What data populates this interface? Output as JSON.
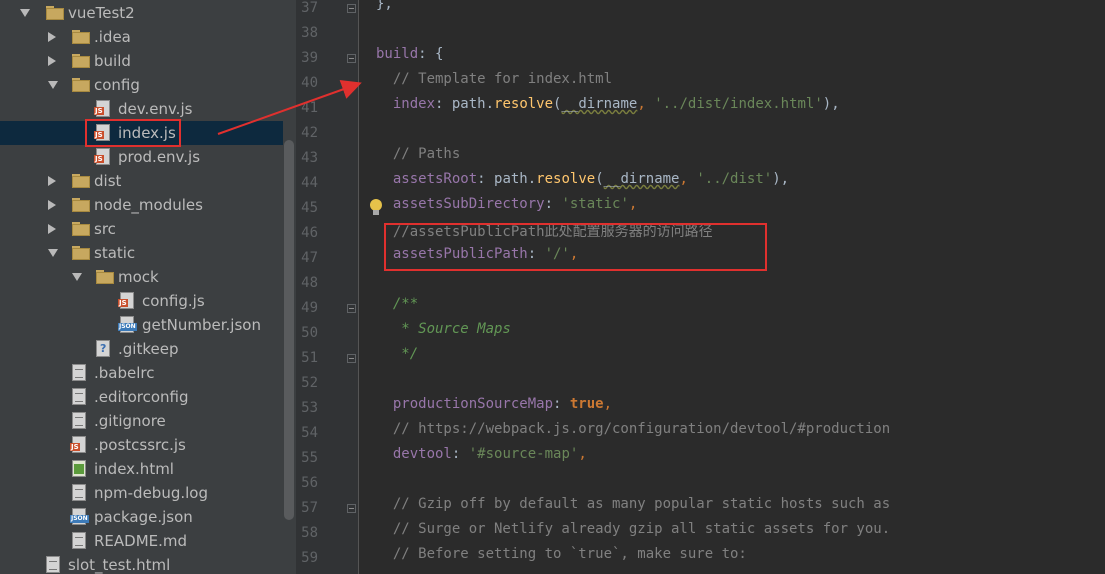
{
  "project_tree": {
    "items": [
      {
        "label": "vueTest2",
        "kind": "folder",
        "depth": 0,
        "expanded": true
      },
      {
        "label": ".idea",
        "kind": "folder",
        "depth": 1,
        "expanded": false
      },
      {
        "label": "build",
        "kind": "folder",
        "depth": 1,
        "expanded": false
      },
      {
        "label": "config",
        "kind": "folder",
        "depth": 1,
        "expanded": true
      },
      {
        "label": "dev.env.js",
        "kind": "js",
        "depth": 2
      },
      {
        "label": "index.js",
        "kind": "js",
        "depth": 2,
        "selected": true
      },
      {
        "label": "prod.env.js",
        "kind": "js",
        "depth": 2
      },
      {
        "label": "dist",
        "kind": "folder",
        "depth": 1,
        "expanded": false
      },
      {
        "label": "node_modules",
        "kind": "folder",
        "depth": 1,
        "expanded": false
      },
      {
        "label": "src",
        "kind": "folder",
        "depth": 1,
        "expanded": false
      },
      {
        "label": "static",
        "kind": "folder",
        "depth": 1,
        "expanded": true
      },
      {
        "label": "mock",
        "kind": "folder",
        "depth": 2,
        "expanded": true
      },
      {
        "label": "config.js",
        "kind": "js",
        "depth": 3
      },
      {
        "label": "getNumber.json",
        "kind": "json",
        "depth": 3
      },
      {
        "label": ".gitkeep",
        "kind": "unknown",
        "depth": 2
      },
      {
        "label": ".babelrc",
        "kind": "text",
        "depth": 1
      },
      {
        "label": ".editorconfig",
        "kind": "text",
        "depth": 1
      },
      {
        "label": ".gitignore",
        "kind": "text",
        "depth": 1
      },
      {
        "label": ".postcssrc.js",
        "kind": "js",
        "depth": 1
      },
      {
        "label": "index.html",
        "kind": "html",
        "depth": 1
      },
      {
        "label": "npm-debug.log",
        "kind": "text",
        "depth": 1
      },
      {
        "label": "package.json",
        "kind": "json",
        "depth": 1
      },
      {
        "label": "README.md",
        "kind": "text",
        "depth": 1
      },
      {
        "label": "slot_test.html",
        "kind": "text",
        "depth": 0
      }
    ]
  },
  "icons": {
    "folder": "folder-icon",
    "js": "js-file-icon",
    "json": "json-file-icon",
    "text": "text-file-icon",
    "html": "html-file-icon",
    "unknown": "unknown-file-icon",
    "fold": "fold-marker-icon",
    "bulb": "lightbulb-icon"
  },
  "editor": {
    "lines": [
      {
        "n": "37",
        "fold": true,
        "tokens": [
          {
            "t": "},",
            "c": "c-dim"
          }
        ]
      },
      {
        "n": "38",
        "tokens": []
      },
      {
        "n": "39",
        "fold": true,
        "tokens": [
          {
            "t": "build",
            "c": "c-prop"
          },
          {
            "t": ": {",
            "c": "c-dim"
          }
        ]
      },
      {
        "n": "40",
        "tokens": [
          {
            "t": "  // Template for index.html",
            "c": "c-comment"
          }
        ]
      },
      {
        "n": "41",
        "tokens": [
          {
            "t": "  ",
            "c": "c-dim"
          },
          {
            "t": "index",
            "c": "c-prop"
          },
          {
            "t": ": path.",
            "c": "c-dim"
          },
          {
            "t": "resolve",
            "c": "c-fn"
          },
          {
            "t": "(",
            "c": "c-dim"
          },
          {
            "t": "__dirname",
            "c": "c-ident"
          },
          {
            "t": ", ",
            "c": "c-op"
          },
          {
            "t": "'../dist/index.html'",
            "c": "c-str"
          },
          {
            "t": "),",
            "c": "c-dim"
          }
        ]
      },
      {
        "n": "42",
        "tokens": []
      },
      {
        "n": "43",
        "tokens": [
          {
            "t": "  // Paths",
            "c": "c-comment"
          }
        ]
      },
      {
        "n": "44",
        "tokens": [
          {
            "t": "  ",
            "c": "c-dim"
          },
          {
            "t": "assetsRoot",
            "c": "c-prop"
          },
          {
            "t": ": path.",
            "c": "c-dim"
          },
          {
            "t": "resolve",
            "c": "c-fn"
          },
          {
            "t": "(",
            "c": "c-dim"
          },
          {
            "t": "__dirname",
            "c": "c-ident"
          },
          {
            "t": ", ",
            "c": "c-op"
          },
          {
            "t": "'../dist'",
            "c": "c-str"
          },
          {
            "t": "),",
            "c": "c-dim"
          }
        ]
      },
      {
        "n": "45",
        "bulb": true,
        "tokens": [
          {
            "t": "  ",
            "c": "c-dim"
          },
          {
            "t": "assetsSubDirectory",
            "c": "c-prop"
          },
          {
            "t": ": ",
            "c": "c-dim"
          },
          {
            "t": "'static'",
            "c": "c-str"
          },
          {
            "t": ",",
            "c": "c-op"
          }
        ]
      },
      {
        "n": "46",
        "tokens": [
          {
            "t": "  //assetsPublicPath",
            "c": "c-comment"
          },
          {
            "t": "此处配置服务器的访问路径",
            "c": "c-cjk"
          }
        ]
      },
      {
        "n": "47",
        "tokens": [
          {
            "t": "  ",
            "c": "c-dim"
          },
          {
            "t": "assetsPublicPath",
            "c": "c-prop"
          },
          {
            "t": ": ",
            "c": "c-dim"
          },
          {
            "t": "'/'",
            "c": "c-str"
          },
          {
            "t": ",",
            "c": "c-op"
          }
        ]
      },
      {
        "n": "48",
        "tokens": []
      },
      {
        "n": "49",
        "fold": true,
        "tokens": [
          {
            "t": "  /**",
            "c": "c-doc"
          }
        ]
      },
      {
        "n": "50",
        "tokens": [
          {
            "t": "   * Source Maps",
            "c": "c-doc"
          }
        ]
      },
      {
        "n": "51",
        "fold": true,
        "tokens": [
          {
            "t": "   */",
            "c": "c-doc"
          }
        ]
      },
      {
        "n": "52",
        "tokens": []
      },
      {
        "n": "53",
        "tokens": [
          {
            "t": "  ",
            "c": "c-dim"
          },
          {
            "t": "productionSourceMap",
            "c": "c-prop"
          },
          {
            "t": ": ",
            "c": "c-dim"
          },
          {
            "t": "true",
            "c": "c-key"
          },
          {
            "t": ",",
            "c": "c-op"
          }
        ]
      },
      {
        "n": "54",
        "tokens": [
          {
            "t": "  // https://webpack.js.org/configuration/devtool/#production",
            "c": "c-comment"
          }
        ]
      },
      {
        "n": "55",
        "tokens": [
          {
            "t": "  ",
            "c": "c-dim"
          },
          {
            "t": "devtool",
            "c": "c-prop"
          },
          {
            "t": ": ",
            "c": "c-dim"
          },
          {
            "t": "'#source-map'",
            "c": "c-str"
          },
          {
            "t": ",",
            "c": "c-op"
          }
        ]
      },
      {
        "n": "56",
        "tokens": []
      },
      {
        "n": "57",
        "fold": true,
        "tokens": [
          {
            "t": "  // Gzip off by default as many popular static hosts such as",
            "c": "c-comment"
          }
        ]
      },
      {
        "n": "58",
        "tokens": [
          {
            "t": "  // Surge or Netlify already gzip all static assets for you.",
            "c": "c-comment"
          }
        ]
      },
      {
        "n": "59",
        "tokens": [
          {
            "t": "  // Before setting to `true`, make sure to:",
            "c": "c-comment"
          }
        ]
      }
    ]
  },
  "annotation": {
    "color": "#e0302e"
  }
}
